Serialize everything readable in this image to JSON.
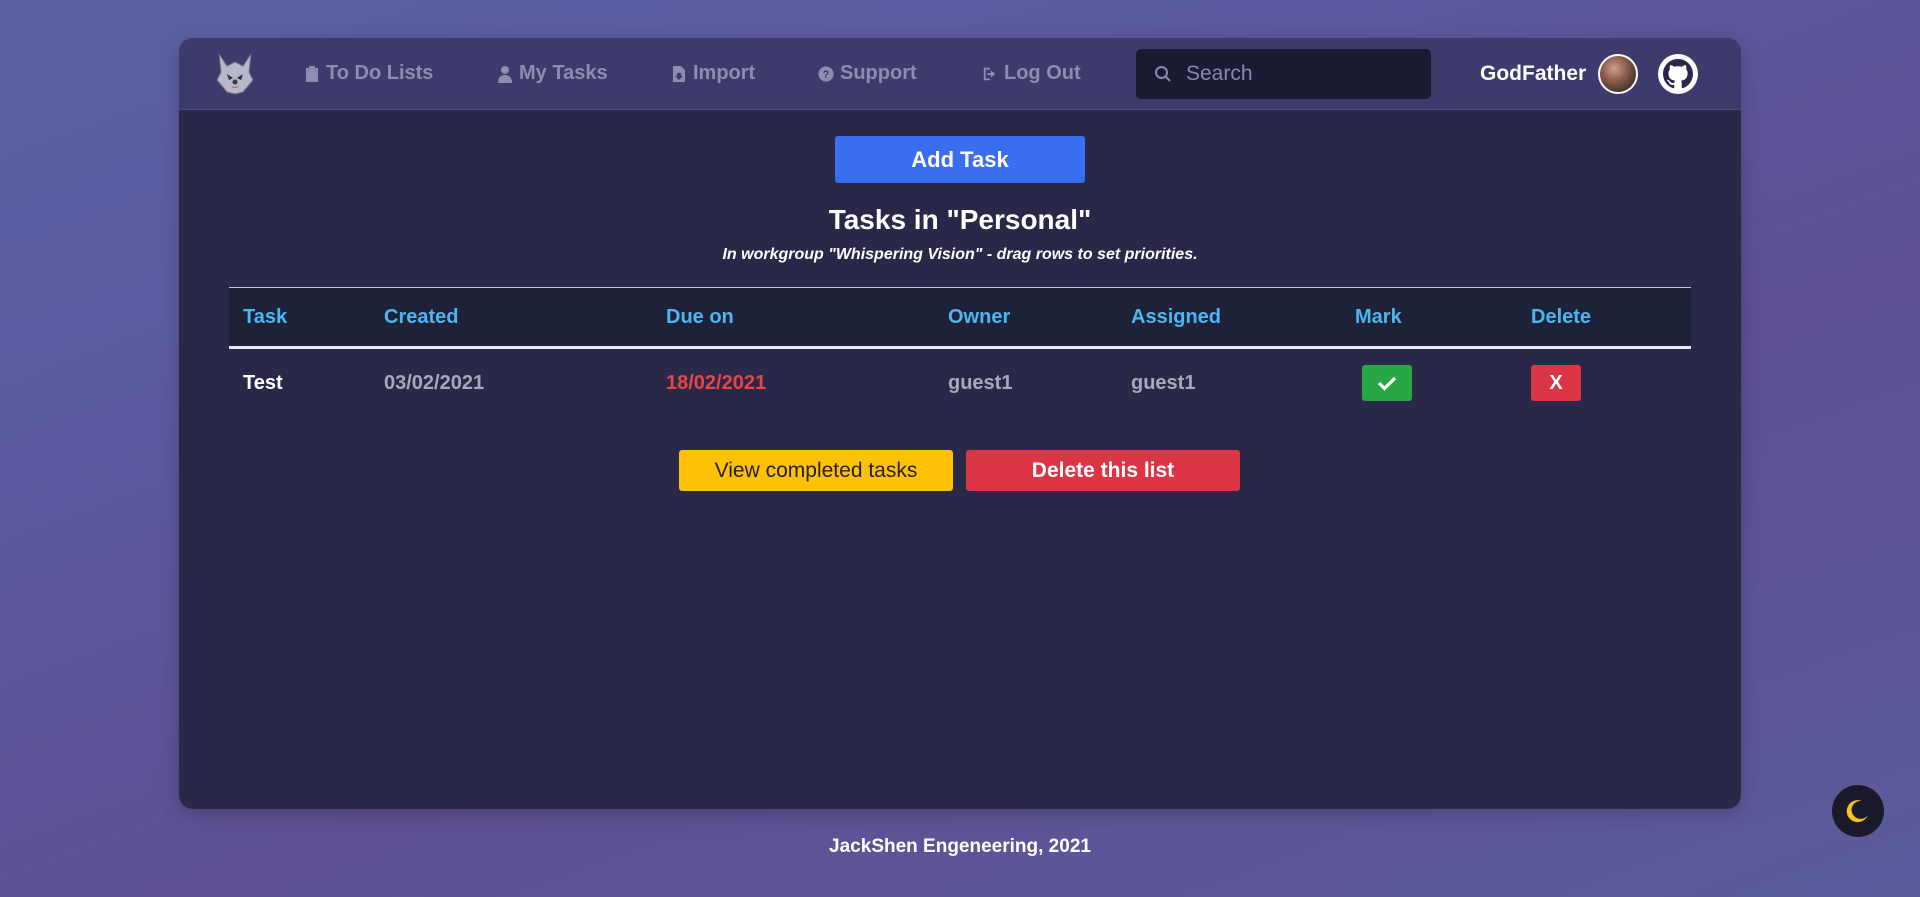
{
  "navbar": {
    "logo_icon": "wolf-logo-icon",
    "items": [
      {
        "label": "To Do Lists",
        "icon": "clipboard-icon"
      },
      {
        "label": "My Tasks",
        "icon": "user-icon"
      },
      {
        "label": "Import",
        "icon": "file-import-icon"
      },
      {
        "label": "Support",
        "icon": "question-circle-icon"
      },
      {
        "label": "Log Out",
        "icon": "sign-out-icon"
      }
    ],
    "search": {
      "placeholder": "Search",
      "value": ""
    },
    "username": "GodFather"
  },
  "main": {
    "add_task_label": "Add Task",
    "title": "Tasks in \"Personal\"",
    "subtitle": "In workgroup \"Whispering Vision\" - drag rows to set priorities.",
    "table": {
      "headers": [
        "Task",
        "Created",
        "Due on",
        "Owner",
        "Assigned",
        "Mark",
        "Delete"
      ],
      "rows": [
        {
          "task": "Test",
          "created": "03/02/2021",
          "due": "18/02/2021",
          "owner": "guest1",
          "assigned": "guest1",
          "delete_label": "X"
        }
      ]
    },
    "view_completed_label": "View completed tasks",
    "delete_list_label": "Delete this list"
  },
  "footer": {
    "text": "JackShen Engeneering, 2021"
  },
  "colors": {
    "accent_blue": "#3a6ef0",
    "header_text": "#4fb5f0",
    "overdue": "#e84545",
    "success": "#28a745",
    "danger": "#dc3545",
    "warning": "#ffc107"
  }
}
